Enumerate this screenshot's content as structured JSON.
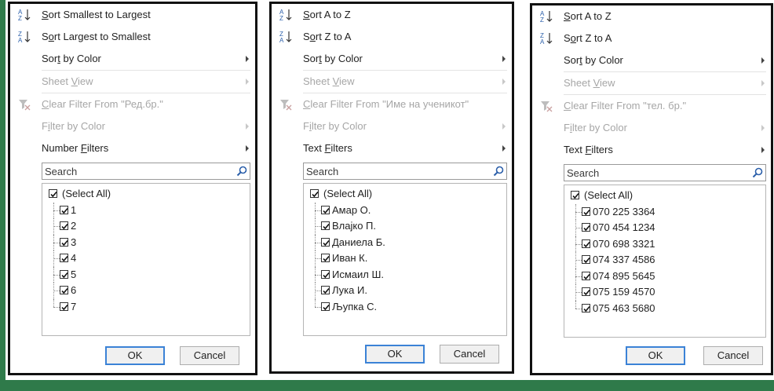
{
  "panels": [
    {
      "menu": {
        "sort_asc": "Sort Smallest to Largest",
        "sort_desc": "Sort Largest to Smallest",
        "sort_color_pre": "Sor",
        "sort_color_u": "t",
        "sort_color_post": " by Color",
        "sheet_view_pre": "Sheet ",
        "sheet_view_u": "V",
        "sheet_view_post": "iew",
        "clear_pre": "",
        "clear_u": "C",
        "clear_post": "lear Filter From \"Ред.бр.\"",
        "filter_color_pre": "F",
        "filter_color_u": "i",
        "filter_color_post": "lter by Color",
        "filters_pre": "Number ",
        "filters_u": "F",
        "filters_post": "ilters",
        "sort_asc_u": "S",
        "sort_asc_rest": "ort Smallest to Largest",
        "sort_desc_pre": "S",
        "sort_desc_u": "o",
        "sort_desc_rest": "rt Largest to Smallest"
      },
      "search": {
        "placeholder": "Search"
      },
      "list": {
        "select_all": "(Select All)",
        "items": [
          "1",
          "2",
          "3",
          "4",
          "5",
          "6",
          "7"
        ]
      },
      "buttons": {
        "ok": "OK",
        "cancel": "Cancel"
      }
    },
    {
      "menu": {
        "sort_asc_u": "S",
        "sort_asc_rest": "ort A to Z",
        "sort_desc_pre": "S",
        "sort_desc_u": "o",
        "sort_desc_rest": "rt Z to A",
        "sort_color_pre": "Sor",
        "sort_color_u": "t",
        "sort_color_post": " by Color",
        "sheet_view_pre": "Sheet ",
        "sheet_view_u": "V",
        "sheet_view_post": "iew",
        "clear_pre": "",
        "clear_u": "C",
        "clear_post": "lear Filter From \"Име на ученикот\"",
        "filter_color_pre": "F",
        "filter_color_u": "i",
        "filter_color_post": "lter by Color",
        "filters_pre": "Text ",
        "filters_u": "F",
        "filters_post": "ilters"
      },
      "search": {
        "placeholder": "Search"
      },
      "list": {
        "select_all": "(Select All)",
        "items": [
          "Амар О.",
          "Влајко П.",
          "Даниела Б.",
          "Иван К.",
          "Исмаил Ш.",
          "Лука И.",
          "Љупка С."
        ]
      },
      "buttons": {
        "ok": "OK",
        "cancel": "Cancel"
      }
    },
    {
      "menu": {
        "sort_asc_u": "S",
        "sort_asc_rest": "ort A to Z",
        "sort_desc_pre": "S",
        "sort_desc_u": "o",
        "sort_desc_rest": "rt Z to A",
        "sort_color_pre": "Sor",
        "sort_color_u": "t",
        "sort_color_post": " by Color",
        "sheet_view_pre": "Sheet ",
        "sheet_view_u": "V",
        "sheet_view_post": "iew",
        "clear_pre": "",
        "clear_u": "C",
        "clear_post": "lear Filter From \"тел. бр.\"",
        "filter_color_pre": "F",
        "filter_color_u": "i",
        "filter_color_post": "lter by Color",
        "filters_pre": "Text ",
        "filters_u": "F",
        "filters_post": "ilters"
      },
      "search": {
        "placeholder": "Search"
      },
      "list": {
        "select_all": "(Select All)",
        "items": [
          "070 225 3364",
          "070 454 1234",
          "070 698 3321",
          "074 337 4586",
          "074 895 5645",
          "075 159 4570",
          "075 463 5680"
        ]
      },
      "buttons": {
        "ok": "OK",
        "cancel": "Cancel"
      }
    }
  ],
  "colors": {
    "accent_green": "#2f7a4a",
    "ok_border": "#3b82d6",
    "sort_icon_blue": "#2b5faa",
    "disabled_text": "#a6a6a6"
  },
  "icons": {
    "sort_asc": "sort-ascending-icon",
    "sort_desc": "sort-descending-icon",
    "clear_filter": "clear-filter-icon",
    "search": "search-icon",
    "submenu": "chevron-right-icon"
  }
}
